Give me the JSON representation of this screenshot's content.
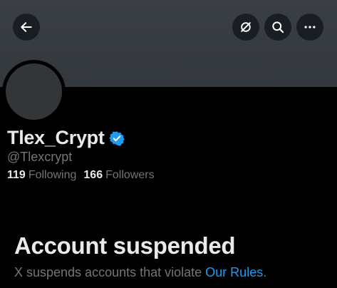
{
  "profile": {
    "display_name": "Tlex_Crypt",
    "handle": "@Tlexcrypt",
    "following_count": "119",
    "following_label": "Following",
    "followers_count": "166",
    "followers_label": "Followers"
  },
  "suspension": {
    "title": "Account suspended",
    "description_prefix": "X suspends accounts that violate ",
    "rules_link": "Our Rules",
    "description_suffix": "."
  },
  "icons": {
    "back": "arrow-left-icon",
    "grok": "grok-icon",
    "search": "search-icon",
    "more": "more-icon",
    "verified": "verified-badge-icon"
  },
  "colors": {
    "background": "#000000",
    "banner": "#36393e",
    "text_primary": "#e7e9ea",
    "text_secondary": "#71767b",
    "link": "#1d9bf0",
    "verified": "#1d9bf0"
  }
}
